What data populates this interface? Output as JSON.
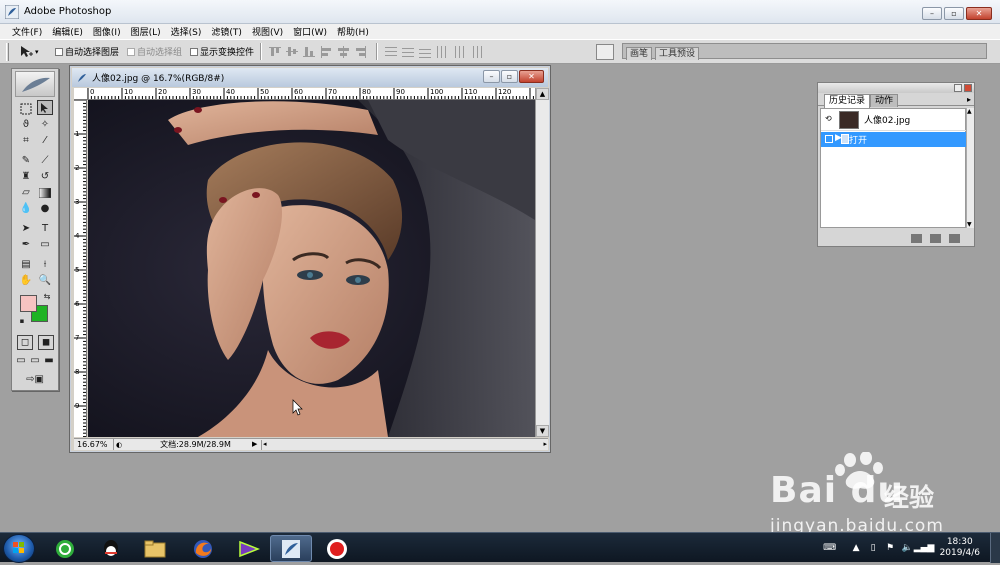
{
  "app": {
    "title": "Adobe Photoshop"
  },
  "menu": [
    "文件(F)",
    "编辑(E)",
    "图像(I)",
    "图层(L)",
    "选择(S)",
    "滤镜(T)",
    "视图(V)",
    "窗口(W)",
    "帮助(H)"
  ],
  "options": {
    "auto_select_layer": "自动选择图层",
    "auto_select_group": "自动选择组",
    "show_transform": "显示变换控件"
  },
  "palette_well": {
    "tab_brushes": "画笔",
    "tab_tool_presets": "工具预设"
  },
  "document": {
    "title": "人像02.jpg @ 16.7%(RGB/8#)",
    "zoom": "16.67%",
    "doc_info": "文档:28.9M/28.9M",
    "ruler_h": [
      "0",
      "10",
      "20",
      "30",
      "40",
      "50",
      "60",
      "70",
      "80",
      "90",
      "100",
      "110",
      "120"
    ],
    "ruler_v": [
      "1",
      "2",
      "3",
      "4",
      "5",
      "6",
      "7",
      "8",
      "9"
    ]
  },
  "history": {
    "tab_history": "历史记录",
    "tab_actions": "动作",
    "snapshot_label": "人像02.jpg",
    "step_label": "打开"
  },
  "colors": {
    "foreground": "#f6c3c1",
    "background": "#1fb324",
    "history_selected": "#3399ff"
  },
  "watermark": {
    "logo": "Bai du",
    "cn": "经验",
    "url": "jingyan.baidu.com"
  },
  "taskbar": {
    "items": [
      "start-button",
      "360-browser",
      "qq",
      "file-explorer",
      "firefox",
      "media-player",
      "photoshop",
      "screen-recorder"
    ],
    "time": "18:30",
    "date": "2019/4/6"
  }
}
